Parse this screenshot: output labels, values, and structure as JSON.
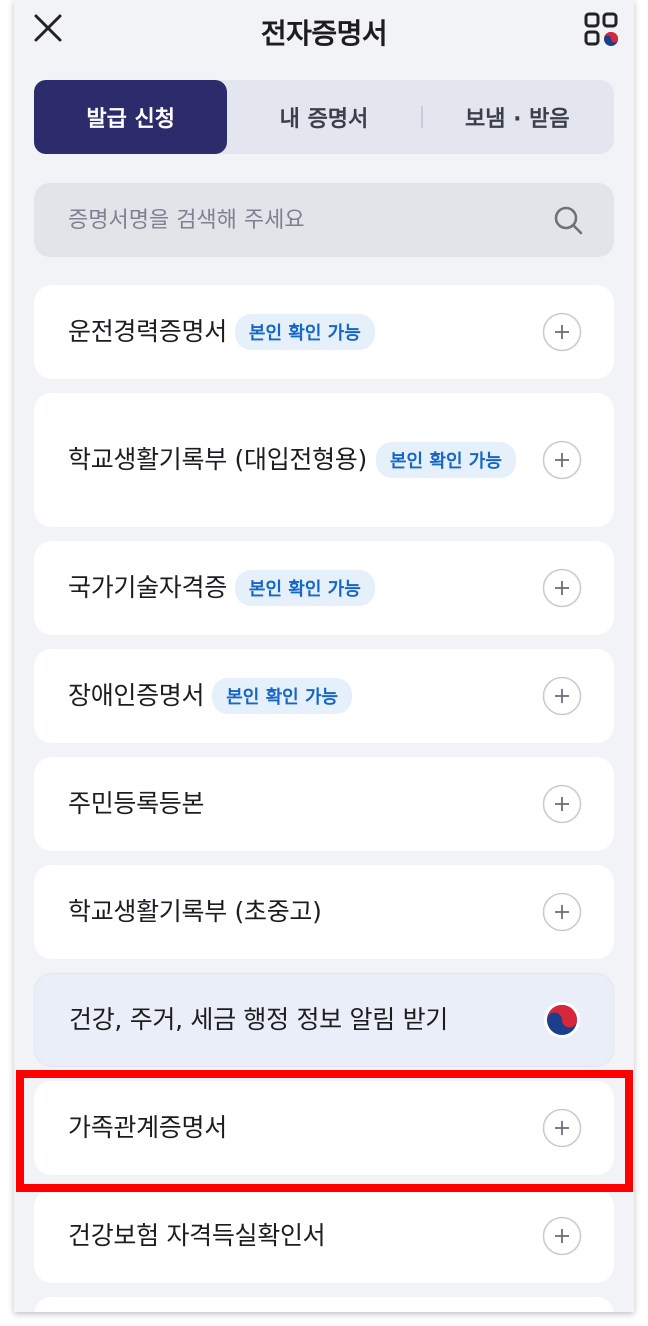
{
  "header": {
    "title": "전자증명서"
  },
  "tabs": [
    {
      "label": "발급 신청",
      "active": true
    },
    {
      "label": "내 증명서",
      "active": false
    },
    {
      "label": "보냄 · 받음",
      "active": false
    }
  ],
  "search": {
    "placeholder": "증명서명을 검색해 주세요"
  },
  "items": [
    {
      "label": "운전경력증명서",
      "badge": "본인 확인 가능"
    },
    {
      "label": "학교생활기록부 (대입전형용)",
      "badge": "본인 확인 가능"
    },
    {
      "label": "국가기술자격증",
      "badge": "본인 확인 가능"
    },
    {
      "label": "장애인증명서",
      "badge": "본인 확인 가능"
    },
    {
      "label": "주민등록등본"
    },
    {
      "label": "학교생활기록부 (초중고)"
    },
    {
      "label": "건강, 주거, 세금 행정 정보 알림 받기"
    },
    {
      "label": "가족관계증명서"
    },
    {
      "label": "건강보험 자격득실확인서"
    }
  ],
  "colors": {
    "active_tab": "#2c2c6c",
    "badge_text": "#1666c7",
    "badge_bg": "#e6f0fb",
    "highlight": "#ff0000"
  }
}
